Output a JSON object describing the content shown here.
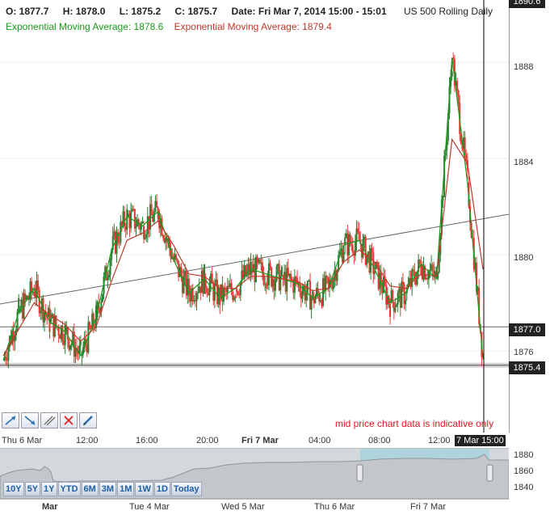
{
  "header": {
    "open": "O: 1877.7",
    "high": "H: 1878.0",
    "low": "L: 1875.2",
    "close": "C: 1875.7",
    "date": "Date: Fri Mar 7, 2014 15:00 - 15:01",
    "symbol": "US 500 Rolling Daily",
    "ema_fast": "Exponential Moving Average: 1878.6",
    "ema_slow": "Exponential Moving Average: 1879.4"
  },
  "colors": {
    "ema_fast": "#1a9a1a",
    "ema_slow": "#c0392b",
    "up_candle": "#2e7d32",
    "down_candle": "#e53935",
    "price_box": "#222222",
    "notice": "#e0141e"
  },
  "price_axis": {
    "ticks": [
      "1888",
      "1884",
      "1880",
      "1876"
    ],
    "top_clipped": "1890.6",
    "current_box": "1877.0",
    "last_box": "1875.4"
  },
  "toolbar": {
    "tools": [
      {
        "icon": "trend-line-icon"
      },
      {
        "icon": "ray-line-icon"
      },
      {
        "icon": "parallel-channel-icon"
      },
      {
        "icon": "delete-drawings-icon"
      },
      {
        "icon": "pencil-icon"
      }
    ]
  },
  "notice": "mid price chart data is indicative only",
  "time_axis": {
    "labels": [
      {
        "text": "Thu 6 Mar",
        "bold": false
      },
      {
        "text": "12:00",
        "bold": false
      },
      {
        "text": "16:00",
        "bold": false
      },
      {
        "text": "20:00",
        "bold": false
      },
      {
        "text": "Fri 7 Mar",
        "bold": true
      },
      {
        "text": "04:00",
        "bold": false
      },
      {
        "text": "08:00",
        "bold": false
      },
      {
        "text": "12:00",
        "bold": false
      }
    ],
    "current": "7 Mar 15:00"
  },
  "navigator": {
    "ticks": [
      "1880",
      "1860",
      "1840"
    ],
    "range_buttons": [
      "10Y",
      "5Y",
      "1Y",
      "YTD",
      "6M",
      "3M",
      "1M",
      "1W",
      "1D",
      "Today"
    ],
    "date_labels": [
      {
        "text": "Mar",
        "bold": true
      },
      {
        "text": "Tue 4 Mar",
        "bold": false
      },
      {
        "text": "Wed 5 Mar",
        "bold": false
      },
      {
        "text": "Thu 6 Mar",
        "bold": false
      },
      {
        "text": "Fri 7 Mar",
        "bold": false
      }
    ]
  },
  "chart_data": {
    "type": "line",
    "ylim": [
      1872.6,
      1890.6
    ],
    "x": [
      "Thu 6 Mar 08:00",
      "Thu 6 Mar 09:00",
      "Thu 6 Mar 10:00",
      "Thu 6 Mar 11:00",
      "Thu 6 Mar 12:00",
      "Thu 6 Mar 13:00",
      "Thu 6 Mar 14:00",
      "Thu 6 Mar 15:00",
      "Thu 6 Mar 16:00",
      "Thu 6 Mar 17:00",
      "Thu 6 Mar 18:00",
      "Thu 6 Mar 19:00",
      "Thu 6 Mar 20:00",
      "Thu 6 Mar 21:00",
      "Thu 6 Mar 22:00",
      "Thu 6 Mar 23:00",
      "Fri 7 Mar 00:00",
      "Fri 7 Mar 01:00",
      "Fri 7 Mar 02:00",
      "Fri 7 Mar 03:00",
      "Fri 7 Mar 04:00",
      "Fri 7 Mar 05:00",
      "Fri 7 Mar 06:00",
      "Fri 7 Mar 07:00",
      "Fri 7 Mar 08:00",
      "Fri 7 Mar 09:00",
      "Fri 7 Mar 10:00",
      "Fri 7 Mar 11:00",
      "Fri 7 Mar 12:00",
      "Fri 7 Mar 13:00",
      "Fri 7 Mar 14:00",
      "Fri 7 Mar 15:00"
    ],
    "series": [
      {
        "values": [
          1875.6,
          1877.6,
          1878.6,
          1877.2,
          1876.8,
          1875.8,
          1877.4,
          1880.2,
          1881.6,
          1881.2,
          1881.8,
          1879.8,
          1878.4,
          1879.0,
          1878.2,
          1878.6,
          1879.4,
          1879.2,
          1879.0,
          1878.8,
          1878.2,
          1878.6,
          1880.4,
          1880.6,
          1879.4,
          1878.0,
          1878.4,
          1879.6,
          1879.0,
          1888.2,
          1883.0,
          1875.7
        ]
      },
      {
        "values": [
          1875.8,
          1876.9,
          1878.0,
          1877.5,
          1877.1,
          1876.4,
          1877.0,
          1878.9,
          1880.6,
          1880.9,
          1881.4,
          1880.4,
          1879.2,
          1879.1,
          1878.6,
          1878.6,
          1879.1,
          1879.1,
          1879.0,
          1878.9,
          1878.5,
          1878.6,
          1879.7,
          1880.2,
          1879.7,
          1878.7,
          1878.6,
          1879.2,
          1879.1,
          1884.8,
          1883.8,
          1879.4
        ]
      }
    ]
  }
}
